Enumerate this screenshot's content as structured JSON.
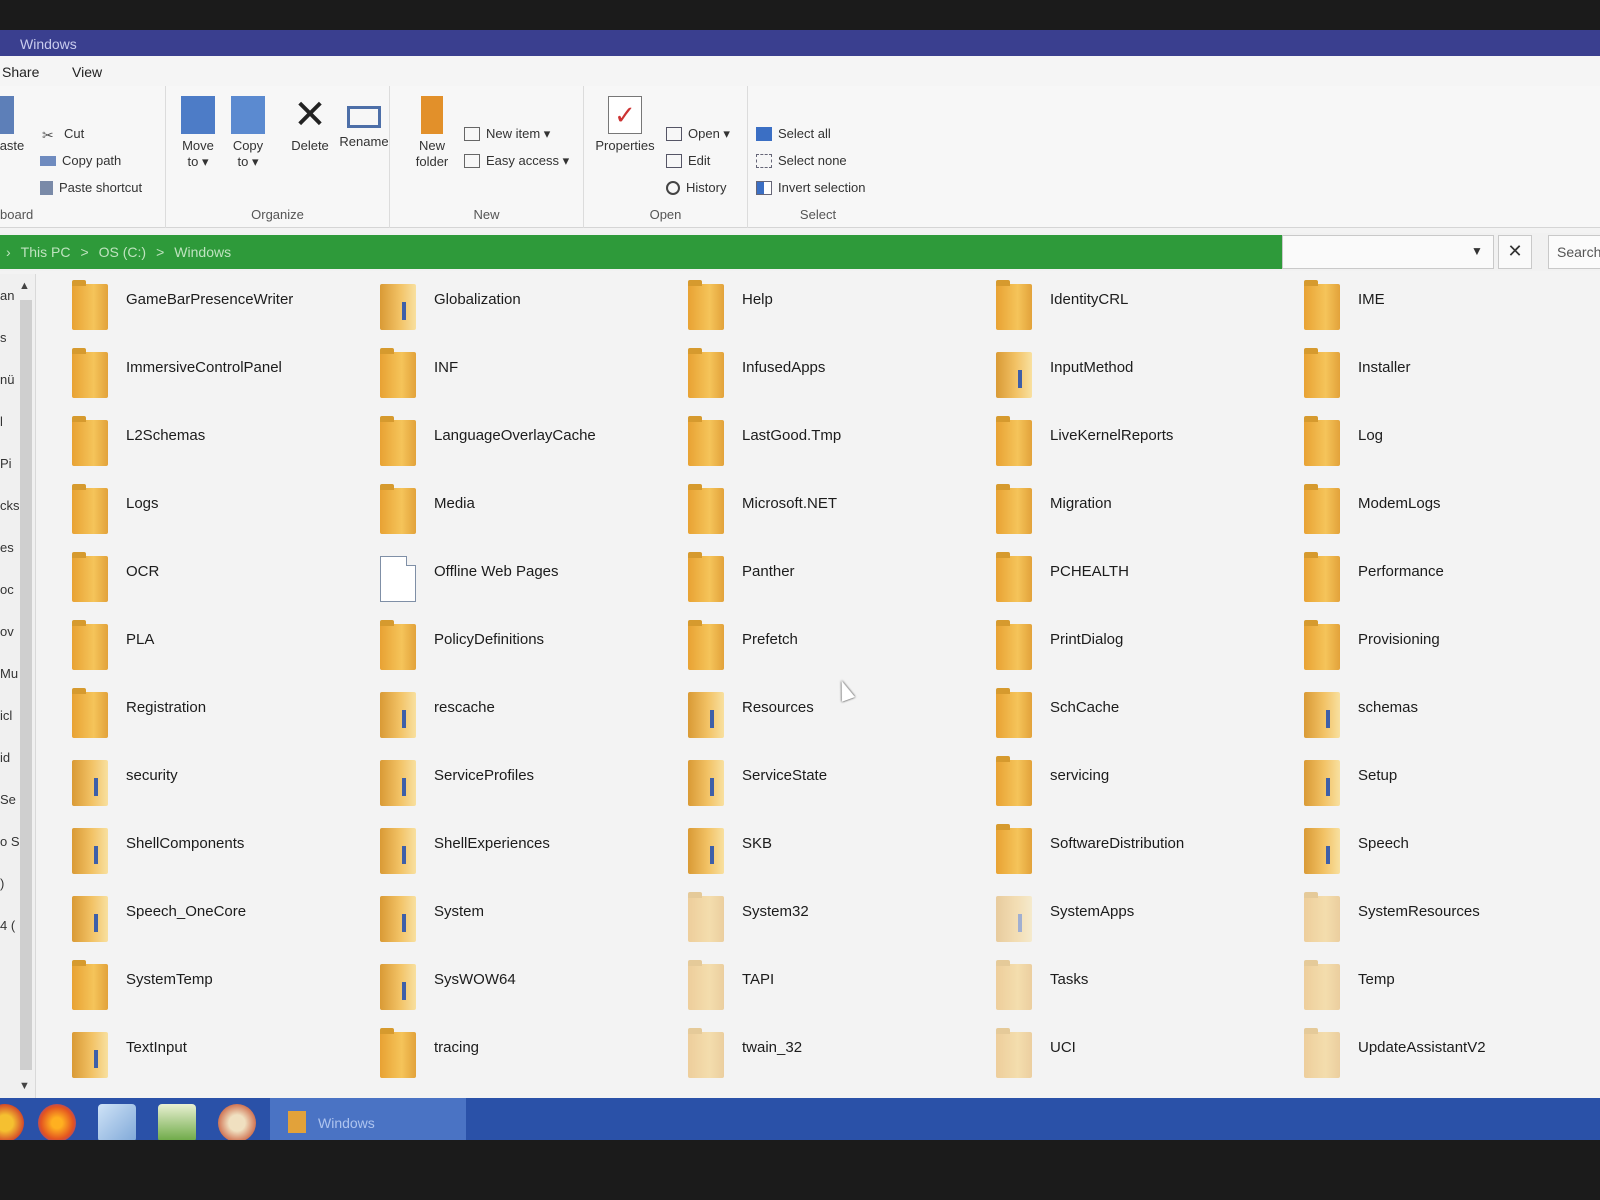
{
  "window": {
    "title": "Windows"
  },
  "menu": {
    "share": "Share",
    "view": "View"
  },
  "ribbon": {
    "clipboard": {
      "paste": "aste",
      "cut": "Cut",
      "copy_path": "Copy path",
      "paste_shortcut": "Paste shortcut",
      "group": "board"
    },
    "organize": {
      "move_to_1": "Move",
      "move_to_2": "to ▾",
      "copy_to_1": "Copy",
      "copy_to_2": "to ▾",
      "delete": "Delete",
      "rename": "Rename",
      "group": "Organize"
    },
    "new": {
      "new_folder_1": "New",
      "new_folder_2": "folder",
      "new_item": "New item ▾",
      "easy_access": "Easy access ▾",
      "group": "New"
    },
    "open": {
      "properties": "Properties",
      "open": "Open ▾",
      "edit": "Edit",
      "history": "History",
      "group": "Open"
    },
    "select": {
      "select_all": "Select all",
      "select_none": "Select none",
      "invert_selection": "Invert selection",
      "group": "Select"
    }
  },
  "address": {
    "crumbs": [
      "This PC",
      "OS (C:)",
      "Windows"
    ],
    "sep": ">",
    "lead": "›",
    "close": "✕",
    "search_placeholder": "Search"
  },
  "nav_fragments": [
    "an",
    "s",
    "nü",
    "l",
    "Pi",
    "cks",
    "es",
    "oc",
    "ov",
    "Mu",
    "icl",
    "id",
    "Se",
    "o S",
    ")",
    "4 ("
  ],
  "items": [
    {
      "name": "GameBarPresenceWriter",
      "icon": "folder-icon"
    },
    {
      "name": "Globalization",
      "icon": "folder-open-icon"
    },
    {
      "name": "Help",
      "icon": "folder-icon"
    },
    {
      "name": "IdentityCRL",
      "icon": "folder-icon"
    },
    {
      "name": "IME",
      "icon": "folder-icon"
    },
    {
      "name": "ImmersiveControlPanel",
      "icon": "folder-icon"
    },
    {
      "name": "INF",
      "icon": "folder-icon"
    },
    {
      "name": "InfusedApps",
      "icon": "folder-icon"
    },
    {
      "name": "InputMethod",
      "icon": "folder-open-icon"
    },
    {
      "name": "Installer",
      "icon": "folder-icon"
    },
    {
      "name": "L2Schemas",
      "icon": "folder-icon"
    },
    {
      "name": "LanguageOverlayCache",
      "icon": "folder-icon"
    },
    {
      "name": "LastGood.Tmp",
      "icon": "folder-icon"
    },
    {
      "name": "LiveKernelReports",
      "icon": "folder-icon"
    },
    {
      "name": "Log",
      "icon": "folder-icon"
    },
    {
      "name": "Logs",
      "icon": "folder-icon"
    },
    {
      "name": "Media",
      "icon": "folder-icon"
    },
    {
      "name": "Microsoft.NET",
      "icon": "folder-icon"
    },
    {
      "name": "Migration",
      "icon": "folder-icon"
    },
    {
      "name": "ModemLogs",
      "icon": "folder-icon"
    },
    {
      "name": "OCR",
      "icon": "folder-icon"
    },
    {
      "name": "Offline Web Pages",
      "icon": "file-icon"
    },
    {
      "name": "Panther",
      "icon": "folder-icon"
    },
    {
      "name": "PCHEALTH",
      "icon": "folder-icon"
    },
    {
      "name": "Performance",
      "icon": "folder-icon"
    },
    {
      "name": "PLA",
      "icon": "folder-icon"
    },
    {
      "name": "PolicyDefinitions",
      "icon": "folder-icon"
    },
    {
      "name": "Prefetch",
      "icon": "folder-icon"
    },
    {
      "name": "PrintDialog",
      "icon": "folder-icon"
    },
    {
      "name": "Provisioning",
      "icon": "folder-icon"
    },
    {
      "name": "Registration",
      "icon": "folder-icon"
    },
    {
      "name": "rescache",
      "icon": "folder-open-icon"
    },
    {
      "name": "Resources",
      "icon": "folder-open-icon"
    },
    {
      "name": "SchCache",
      "icon": "folder-icon"
    },
    {
      "name": "schemas",
      "icon": "folder-open-icon"
    },
    {
      "name": "security",
      "icon": "folder-open-icon"
    },
    {
      "name": "ServiceProfiles",
      "icon": "folder-open-icon"
    },
    {
      "name": "ServiceState",
      "icon": "folder-open-icon"
    },
    {
      "name": "servicing",
      "icon": "folder-icon"
    },
    {
      "name": "Setup",
      "icon": "folder-open-icon"
    },
    {
      "name": "ShellComponents",
      "icon": "folder-open-icon"
    },
    {
      "name": "ShellExperiences",
      "icon": "folder-open-icon"
    },
    {
      "name": "SKB",
      "icon": "folder-open-icon"
    },
    {
      "name": "SoftwareDistribution",
      "icon": "folder-icon"
    },
    {
      "name": "Speech",
      "icon": "folder-open-icon"
    },
    {
      "name": "Speech_OneCore",
      "icon": "folder-open-icon"
    },
    {
      "name": "System",
      "icon": "folder-open-icon"
    },
    {
      "name": "System32",
      "icon": "folder-icon"
    },
    {
      "name": "SystemApps",
      "icon": "folder-open-icon"
    },
    {
      "name": "SystemResources",
      "icon": "folder-icon"
    },
    {
      "name": "SystemTemp",
      "icon": "folder-icon"
    },
    {
      "name": "SysWOW64",
      "icon": "folder-open-icon"
    },
    {
      "name": "TAPI",
      "icon": "folder-icon"
    },
    {
      "name": "Tasks",
      "icon": "folder-icon"
    },
    {
      "name": "Temp",
      "icon": "folder-icon"
    },
    {
      "name": "TextInput",
      "icon": "folder-open-icon"
    },
    {
      "name": "tracing",
      "icon": "folder-icon"
    },
    {
      "name": "twain_32",
      "icon": "folder-icon"
    },
    {
      "name": "UCI",
      "icon": "folder-icon"
    },
    {
      "name": "UpdateAssistantV2",
      "icon": "folder-icon"
    }
  ],
  "taskbar": {
    "window_label": "Windows",
    "apps": [
      "chrome-icon",
      "firefox-icon",
      "notepad-icon",
      "editor-icon",
      "paint-icon"
    ]
  }
}
